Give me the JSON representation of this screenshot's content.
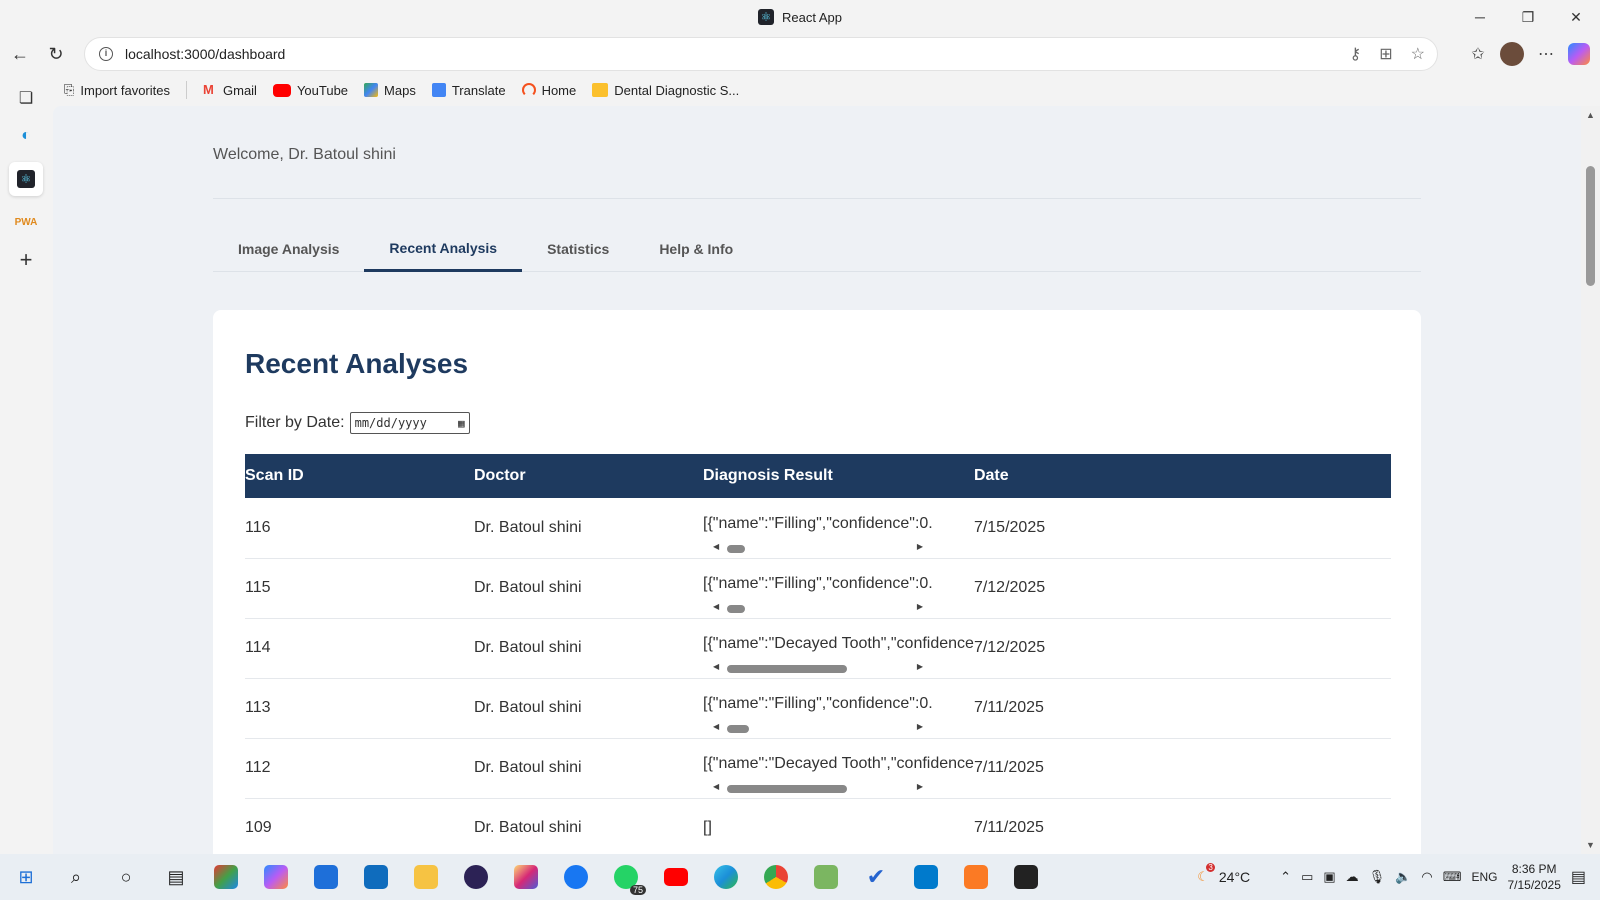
{
  "window": {
    "title": "React App"
  },
  "browser": {
    "url": "localhost:3000/dashboard",
    "bookmarks": [
      {
        "label": "Import favorites",
        "color": "#444"
      },
      {
        "label": "Gmail",
        "color": "#ea4335"
      },
      {
        "label": "YouTube",
        "color": "#ff0000"
      },
      {
        "label": "Maps",
        "color": "#34a853"
      },
      {
        "label": "Translate",
        "color": "#4285f4"
      },
      {
        "label": "Home",
        "color": "#f4511e"
      },
      {
        "label": "Dental Diagnostic S...",
        "color": "#fbc02d"
      }
    ]
  },
  "page": {
    "welcome": "Welcome, Dr. Batoul shini",
    "tabs": [
      "Image Analysis",
      "Recent Analysis",
      "Statistics",
      "Help & Info"
    ],
    "active_tab": "Recent Analysis",
    "section_title": "Recent Analyses",
    "filter_label": "Filter by Date:",
    "date_placeholder": "mm/dd/yyyy",
    "table": {
      "headers": [
        "Scan ID",
        "Doctor",
        "Diagnosis Result",
        "Date"
      ],
      "rows": [
        {
          "id": "116",
          "doctor": "Dr. Batoul shini",
          "result": "[{\"name\":\"Filling\",\"confidence\":0.",
          "date": "7/15/2025",
          "thumb": 0.09
        },
        {
          "id": "115",
          "doctor": "Dr. Batoul shini",
          "result": "[{\"name\":\"Filling\",\"confidence\":0.",
          "date": "7/12/2025",
          "thumb": 0.09
        },
        {
          "id": "114",
          "doctor": "Dr. Batoul shini",
          "result": "[{\"name\":\"Decayed Tooth\",\"confidence",
          "date": "7/12/2025",
          "thumb": 0.6
        },
        {
          "id": "113",
          "doctor": "Dr. Batoul shini",
          "result": "[{\"name\":\"Filling\",\"confidence\":0.",
          "date": "7/11/2025",
          "thumb": 0.11
        },
        {
          "id": "112",
          "doctor": "Dr. Batoul shini",
          "result": "[{\"name\":\"Decayed Tooth\",\"confidence",
          "date": "7/11/2025",
          "thumb": 0.6
        },
        {
          "id": "109",
          "doctor": "Dr. Batoul shini",
          "result": "[]",
          "date": "7/11/2025",
          "thumb": null
        }
      ]
    }
  },
  "taskbar": {
    "weather": "24°C",
    "lang": "ENG",
    "time": "8:36 PM",
    "date": "7/15/2025",
    "whatsapp_badge": "75",
    "weather_badge": "3"
  }
}
